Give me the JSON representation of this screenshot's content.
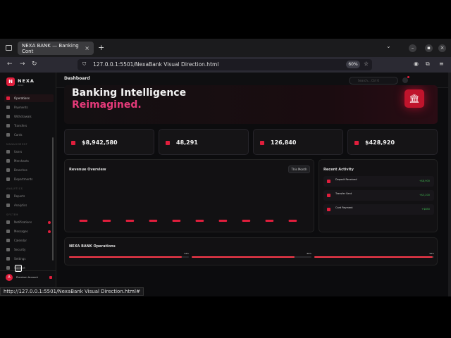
{
  "browser": {
    "tab_title": "NEXA BANK — Banking Cont",
    "tab_close": "×",
    "new_tab": "+",
    "url": "127.0.0.1:5501/NexaBank Visual Direction.html",
    "zoom": "60%",
    "status_url": "http://127.0.0.1:5501/NexaBank Visual Direction.html#"
  },
  "sidebar": {
    "logo_mark": "N",
    "brand": "NEXA",
    "brand_sub": "BANK",
    "sections": [
      "MANAGEMENT",
      "ANALYTICS",
      "SYSTEM"
    ],
    "items": [
      {
        "label": "Operations",
        "active": true
      },
      {
        "label": "Payments"
      },
      {
        "label": "Withdrawals"
      },
      {
        "label": "Transfers"
      },
      {
        "label": "Cards"
      },
      {
        "label": "Users"
      },
      {
        "label": "Merchants"
      },
      {
        "label": "Branches"
      },
      {
        "label": "Departments"
      },
      {
        "label": "Reports"
      },
      {
        "label": "Analytics"
      },
      {
        "label": "Notifications",
        "dot": true
      },
      {
        "label": "Messages",
        "dot": true
      },
      {
        "label": "Calendar"
      },
      {
        "label": "Security"
      },
      {
        "label": "Settings"
      },
      {
        "label": "Support"
      }
    ],
    "user_initial": "A",
    "user_name": "Premium Account"
  },
  "topbar": {
    "title": "Dashboard",
    "search_placeholder": "Search… Ctrl K"
  },
  "hero": {
    "line1": "Banking Intelligence",
    "line2": "Reimagined."
  },
  "stats": [
    {
      "value": "$8,942,580"
    },
    {
      "value": "48,291"
    },
    {
      "value": "126,840"
    },
    {
      "value": "$428,920"
    }
  ],
  "chart": {
    "button": "This Month",
    "title": "Revenue Overview",
    "bar_color": "#e01e3c"
  },
  "chart_data": {
    "type": "bar",
    "title": "Revenue Overview",
    "categories": [
      "",
      "",
      "",
      "",
      "",
      "",
      "",
      "",
      "",
      ""
    ],
    "values": [
      1,
      1,
      1,
      1,
      1,
      1,
      1,
      1,
      1,
      1
    ],
    "ylim": [
      0,
      20
    ],
    "grid": false
  },
  "activity": {
    "title": "Recent Activity",
    "rows": [
      {
        "name": "Deposit Received",
        "amount": "+$8,900"
      },
      {
        "name": "Transfer Sent",
        "amount": "+$3,200"
      },
      {
        "name": "Card Payment",
        "amount": "+$850"
      }
    ]
  },
  "operations": {
    "title": "NEXA BANK Operations",
    "metrics": [
      {
        "percent": "94%",
        "value": 0.94
      },
      {
        "percent": "86%",
        "value": 0.86
      },
      {
        "percent": "99%",
        "value": 0.99
      }
    ]
  },
  "colors": {
    "accent": "#e01e3c",
    "positive": "#3fb950",
    "gradient_text": "#e63a7a"
  }
}
